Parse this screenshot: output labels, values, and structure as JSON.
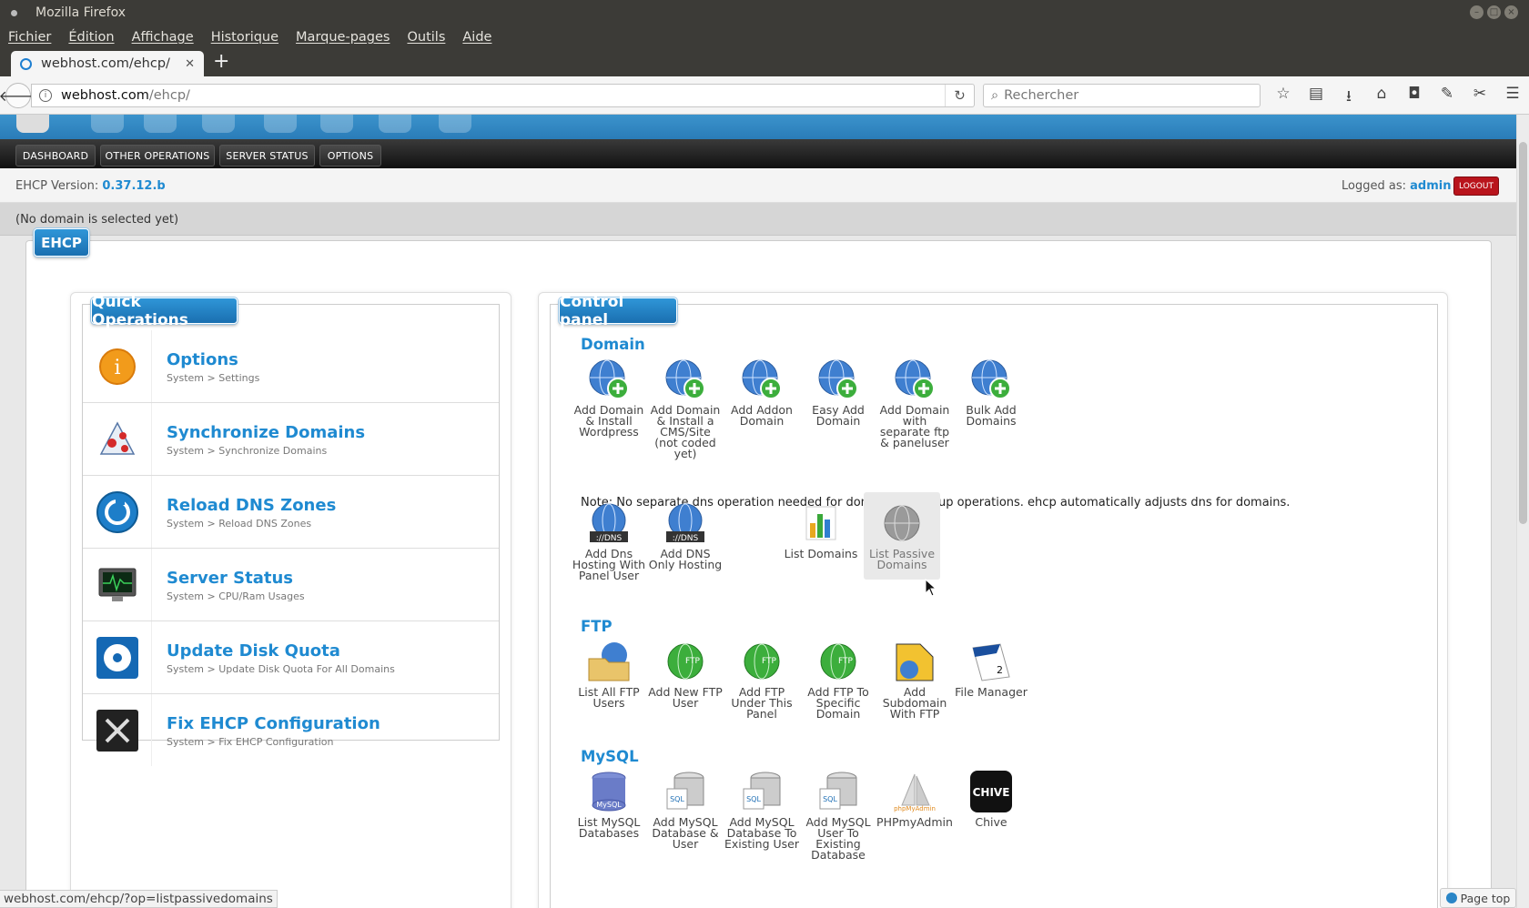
{
  "window": {
    "title": "Mozilla Firefox"
  },
  "menubar": [
    "Fichier",
    "Édition",
    "Affichage",
    "Historique",
    "Marque-pages",
    "Outils",
    "Aide"
  ],
  "tab": {
    "title": "webhost.com/ehcp/"
  },
  "url": {
    "host": "webhost.com",
    "path": "/ehcp/"
  },
  "search": {
    "placeholder": "Rechercher"
  },
  "nav_buttons": [
    "DASHBOARD",
    "OTHER OPERATIONS",
    "SERVER STATUS",
    "OPTIONS"
  ],
  "info": {
    "version_label": "EHCP Version:",
    "version": "0.37.12.b",
    "logged_label": "Logged as:",
    "user": "admin",
    "logout": "LOGOUT"
  },
  "domain_status": "(No domain is selected yet)",
  "main_badge": "EHCP",
  "quick": {
    "title": "Quick Operations",
    "items": [
      {
        "title": "Options",
        "sub": "System > Settings"
      },
      {
        "title": "Synchronize Domains",
        "sub": "System > Synchronize Domains"
      },
      {
        "title": "Reload DNS Zones",
        "sub": "System > Reload DNS Zones"
      },
      {
        "title": "Server Status",
        "sub": "System > CPU/Ram Usages"
      },
      {
        "title": "Update Disk Quota",
        "sub": "System > Update Disk Quota For All Domains"
      },
      {
        "title": "Fix EHCP Configuration",
        "sub": "System > Fix EHCP Configuration"
      }
    ]
  },
  "cp": {
    "title": "Control panel",
    "domain_title": "Domain",
    "domain_ops": [
      "Add Domain & Install Wordpress",
      "Add Domain & Install a CMS/Site (not coded yet)",
      "Add Addon Domain",
      "Easy Add Domain",
      "Add Domain with separate ftp & paneluser",
      "Bulk Add Domains"
    ],
    "note": "Note: No separate dns operation needed for domain add/setup operations. ehcp automatically adjusts dns for domains.",
    "dns_ops": [
      "Add Dns Hosting With Panel User",
      "Add DNS Only Hosting",
      "List Domains",
      "List Passive Domains"
    ],
    "ftp_title": "FTP",
    "ftp_ops": [
      "List All FTP Users",
      "Add New FTP User",
      "Add FTP Under This Panel",
      "Add FTP To Specific Domain",
      "Add Subdomain With FTP",
      "File Manager"
    ],
    "mysql_title": "MySQL",
    "mysql_ops": [
      "List MySQL Databases",
      "Add MySQL Database & User",
      "Add MySQL Database To Existing User",
      "Add MySQL User To Existing Database",
      "PHPmyAdmin",
      "Chive"
    ]
  },
  "status_url": "webhost.com/ehcp/?op=listpassivedomains",
  "page_top": "Page top"
}
